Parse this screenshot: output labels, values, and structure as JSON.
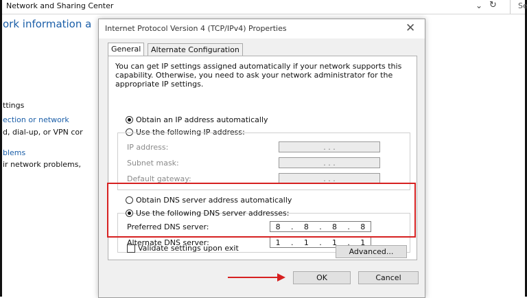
{
  "background": {
    "title": "Network and Sharing Center",
    "search_text": "Se",
    "heading": "ork information a",
    "lines": [
      {
        "text": "ttings",
        "link": false
      },
      {
        "text": "ection or network",
        "link": true
      },
      {
        "text": "d, dial-up, or VPN cor",
        "link": false
      },
      {
        "text": "blems",
        "link": true
      },
      {
        "text": "ir network problems,",
        "link": false
      }
    ]
  },
  "dialog": {
    "title": "Internet Protocol Version 4 (TCP/IPv4) Properties",
    "tabs": [
      "General",
      "Alternate Configuration"
    ],
    "info": "You can get IP settings assigned automatically if your network supports this capability. Otherwise, you need to ask your network administrator for the appropriate IP settings.",
    "ip_auto": "Obtain an IP address automatically",
    "ip_manual": "Use the following IP address:",
    "ip_fields": [
      {
        "label": "IP address:",
        "value": ". . ."
      },
      {
        "label": "Subnet mask:",
        "value": ". . ."
      },
      {
        "label": "Default gateway:",
        "value": ". . ."
      }
    ],
    "dns_auto": "Obtain DNS server address automatically",
    "dns_manual": "Use the following DNS server addresses:",
    "dns_fields": [
      {
        "label": "Preferred DNS server:",
        "value": [
          "8",
          "8",
          "8",
          "8"
        ]
      },
      {
        "label": "Alternate DNS server:",
        "value": [
          "1",
          "1",
          "1",
          "1"
        ]
      }
    ],
    "validate": "Validate settings upon exit",
    "advanced": "Advanced...",
    "ok": "OK",
    "cancel": "Cancel"
  },
  "colors": {
    "highlight": "#d62020",
    "link": "#1a5ea8"
  }
}
